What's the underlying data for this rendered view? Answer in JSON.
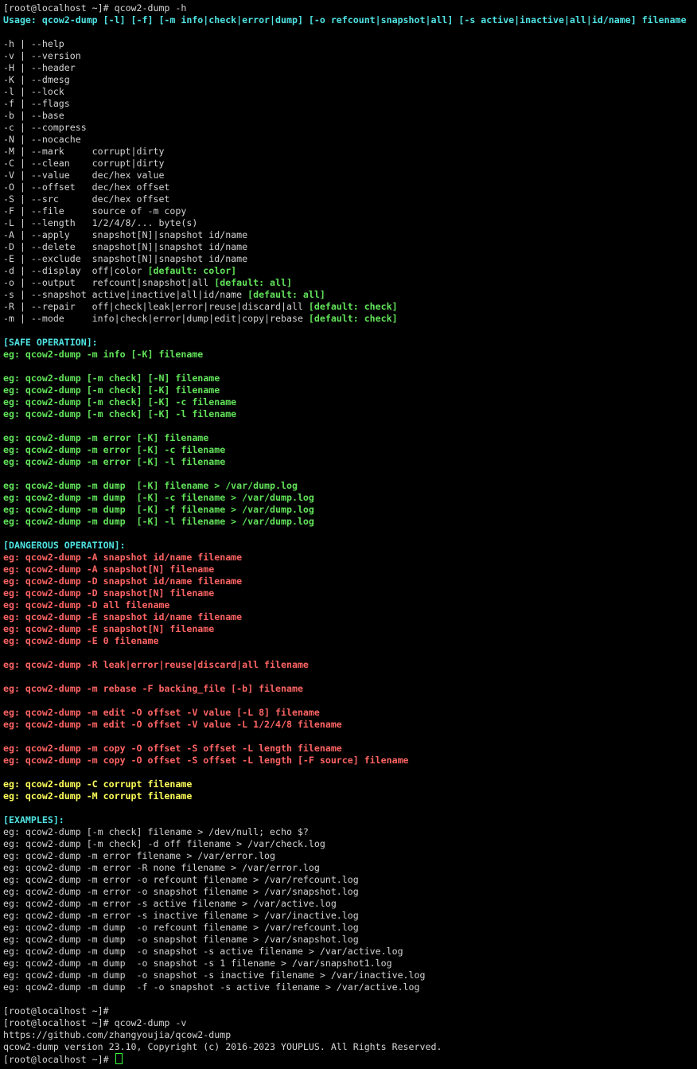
{
  "prompt": "[root@localhost ~]# ",
  "cmd1": "qcow2-dump -h",
  "usage": "Usage: qcow2-dump [-l] [-f] [-m info|check|error|dump] [-o refcount|snapshot|all] [-s active|inactive|all|id/name] filename",
  "options": [
    {
      "text": "-h | --help"
    },
    {
      "text": "-v | --version"
    },
    {
      "text": "-H | --header"
    },
    {
      "text": "-K | --dmesg"
    },
    {
      "text": "-l | --lock"
    },
    {
      "text": "-f | --flags"
    },
    {
      "text": "-b | --base"
    },
    {
      "text": "-c | --compress"
    },
    {
      "text": "-N | --nocache"
    },
    {
      "text": "-M | --mark     corrupt|dirty"
    },
    {
      "text": "-C | --clean    corrupt|dirty"
    },
    {
      "text": "-V | --value    dec/hex value"
    },
    {
      "text": "-O | --offset   dec/hex offset"
    },
    {
      "text": "-S | --src      dec/hex offset"
    },
    {
      "text": "-F | --file     source of -m copy"
    },
    {
      "text": "-L | --length   1/2/4/8/... byte(s)"
    },
    {
      "text": "-A | --apply    snapshot[N]|snapshot id/name"
    },
    {
      "text": "-D | --delete   snapshot[N]|snapshot id/name"
    },
    {
      "text": "-E | --exclude  snapshot[N]|snapshot id/name"
    },
    {
      "text": "-d | --display  off|color ",
      "def": "[default: color]"
    },
    {
      "text": "-o | --output   refcount|snapshot|all ",
      "def": "[default: all]"
    },
    {
      "text": "-s | --snapshot active|inactive|all|id/name ",
      "def": "[default: all]"
    },
    {
      "text": "-R | --repair   off|check|leak|error|reuse|discard|all ",
      "def": "[default: check]"
    },
    {
      "text": "-m | --mode     info|check|error|dump|edit|copy|rebase ",
      "def": "[default: check]"
    }
  ],
  "safe_header": "[SAFE OPERATION]:",
  "safe_groups": [
    [
      "eg: qcow2-dump -m info [-K] filename"
    ],
    [
      "eg: qcow2-dump [-m check] [-N] filename",
      "eg: qcow2-dump [-m check] [-K] filename",
      "eg: qcow2-dump [-m check] [-K] -c filename",
      "eg: qcow2-dump [-m check] [-K] -l filename"
    ],
    [
      "eg: qcow2-dump -m error [-K] filename",
      "eg: qcow2-dump -m error [-K] -c filename",
      "eg: qcow2-dump -m error [-K] -l filename"
    ],
    [
      "eg: qcow2-dump -m dump  [-K] filename > /var/dump.log",
      "eg: qcow2-dump -m dump  [-K] -c filename > /var/dump.log",
      "eg: qcow2-dump -m dump  [-K] -f filename > /var/dump.log",
      "eg: qcow2-dump -m dump  [-K] -l filename > /var/dump.log"
    ]
  ],
  "danger_header": "[DANGEROUS OPERATION]:",
  "danger_groups": [
    [
      "eg: qcow2-dump -A snapshot id/name filename",
      "eg: qcow2-dump -A snapshot[N] filename",
      "eg: qcow2-dump -D snapshot id/name filename",
      "eg: qcow2-dump -D snapshot[N] filename",
      "eg: qcow2-dump -D all filename",
      "eg: qcow2-dump -E snapshot id/name filename",
      "eg: qcow2-dump -E snapshot[N] filename",
      "eg: qcow2-dump -E 0 filename"
    ],
    [
      "eg: qcow2-dump -R leak|error|reuse|discard|all filename"
    ],
    [
      "eg: qcow2-dump -m rebase -F backing_file [-b] filename"
    ],
    [
      "eg: qcow2-dump -m edit -O offset -V value [-L 8] filename",
      "eg: qcow2-dump -m edit -O offset -V value -L 1/2/4/8 filename"
    ],
    [
      "eg: qcow2-dump -m copy -O offset -S offset -L length filename",
      "eg: qcow2-dump -m copy -O offset -S offset -L length [-F source] filename"
    ]
  ],
  "corrupt_lines": [
    "eg: qcow2-dump -C corrupt filename",
    "eg: qcow2-dump -M corrupt filename"
  ],
  "examples_header": "[EXAMPLES]:",
  "examples": [
    "eg: qcow2-dump [-m check] filename > /dev/null; echo $?",
    "eg: qcow2-dump [-m check] -d off filename > /var/check.log",
    "eg: qcow2-dump -m error filename > /var/error.log",
    "eg: qcow2-dump -m error -R none filename > /var/error.log",
    "eg: qcow2-dump -m error -o refcount filename > /var/refcount.log",
    "eg: qcow2-dump -m error -o snapshot filename > /var/snapshot.log",
    "eg: qcow2-dump -m error -s active filename > /var/active.log",
    "eg: qcow2-dump -m error -s inactive filename > /var/inactive.log",
    "eg: qcow2-dump -m dump  -o refcount filename > /var/refcount.log",
    "eg: qcow2-dump -m dump  -o snapshot filename > /var/snapshot.log",
    "eg: qcow2-dump -m dump  -o snapshot -s active filename > /var/active.log",
    "eg: qcow2-dump -m dump  -o snapshot -s 1 filename > /var/snapshot1.log",
    "eg: qcow2-dump -m dump  -o snapshot -s inactive filename > /var/inactive.log",
    "eg: qcow2-dump -m dump  -f -o snapshot -s active filename > /var/active.log"
  ],
  "cmd2": "qcow2-dump -v",
  "url_line": "https://github.com/zhangyoujia/qcow2-dump",
  "version_line": "qcow2-dump version 23.10, Copyright (c) 2016-2023 YOUPLUS. All Rights Reserved.",
  "colors": {
    "background": "#000000",
    "text": "#d4d4d4",
    "cyan": "#4fe3e3",
    "green": "#62e45a",
    "red": "#ff6464",
    "yellow": "#ffff5a"
  }
}
